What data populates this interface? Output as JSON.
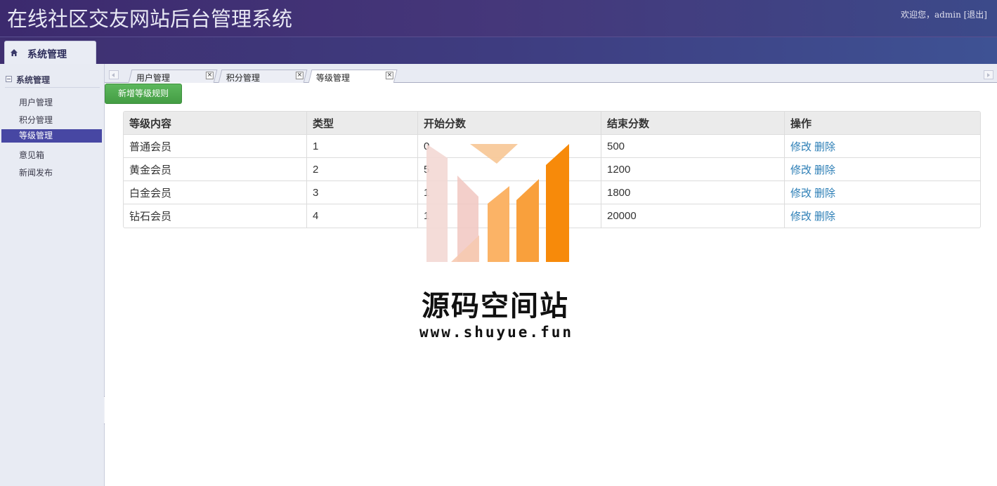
{
  "header": {
    "title": "在线社区交友网站后台管理系统",
    "welcome": "欢迎您，",
    "username": "admin",
    "logout": "[退出]"
  },
  "topnav": {
    "tab_label": "系统管理",
    "tab_icon": "home-icon"
  },
  "sidebar": {
    "heading": "系统管理",
    "items": [
      {
        "label": "用户管理",
        "active": false
      },
      {
        "label": "积分管理",
        "active": false
      },
      {
        "label": "等级管理",
        "active": true
      },
      {
        "label": "意见箱",
        "active": false
      },
      {
        "label": "新闻发布",
        "active": false
      }
    ]
  },
  "tabs": [
    {
      "label": "用户管理",
      "close": "×",
      "active": false
    },
    {
      "label": "积分管理",
      "close": "×",
      "active": false
    },
    {
      "label": "等级管理",
      "close": "×",
      "active": true
    }
  ],
  "toolbar": {
    "add_label": "新增等级规则"
  },
  "table": {
    "headers": [
      "等级内容",
      "类型",
      "开始分数",
      "结束分数",
      "操作"
    ],
    "rows": [
      {
        "name": "普通会员",
        "type": "1",
        "start": "0",
        "end": "500"
      },
      {
        "name": "黄金会员",
        "type": "2",
        "start": "5",
        "end": "1200"
      },
      {
        "name": "白金会员",
        "type": "3",
        "start": "1",
        "end": "1800"
      },
      {
        "name": "钻石会员",
        "type": "4",
        "start": "1",
        "end": "20000"
      }
    ],
    "edit_label": "修改",
    "delete_label": "删除"
  },
  "watermark": {
    "title": "源码空间站",
    "url": "www.shuyue.fun"
  },
  "colors": {
    "header": "#45377a",
    "active_item": "#4747a3",
    "add_button": "#5cb85c",
    "link": "#2a7db5",
    "watermark_orange": "#f78a0a"
  }
}
